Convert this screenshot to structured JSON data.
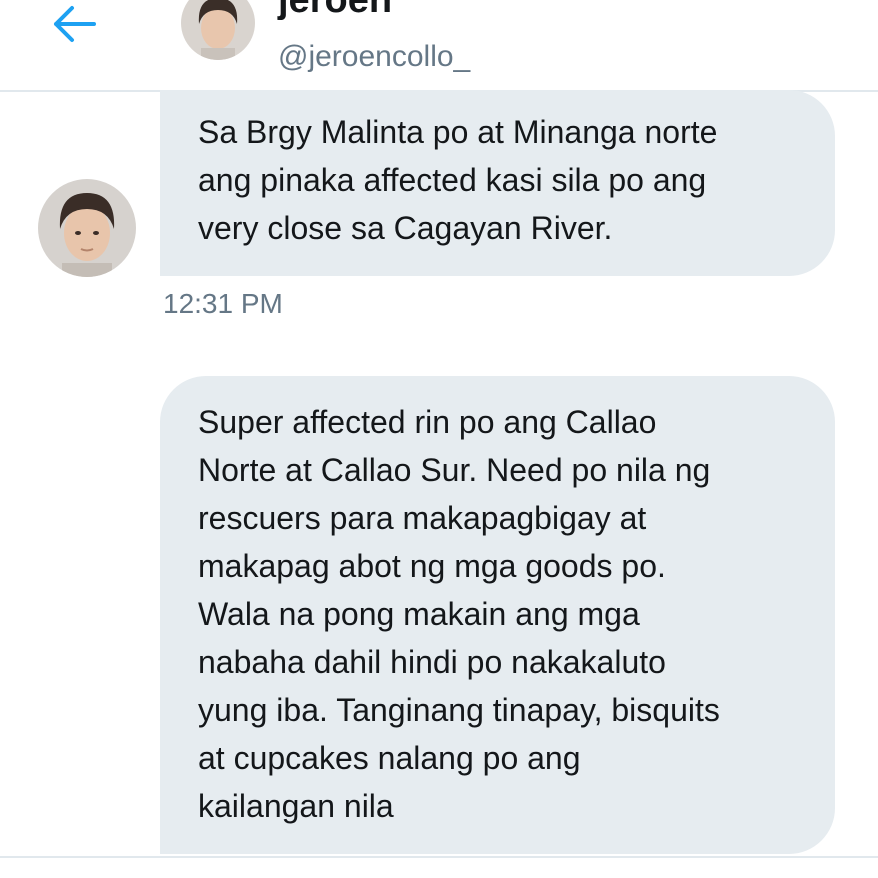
{
  "header": {
    "back_icon": "arrow-left-icon",
    "name": "jeroen",
    "handle": "@jeroencollo_",
    "accent_color": "#1da1f2"
  },
  "messages": [
    {
      "text": "Sa Brgy Malinta po at Minanga norte\nang pinaka affected kasi sila po ang\nvery close sa Cagayan River.",
      "timestamp": "12:31 PM"
    },
    {
      "text": "Super affected rin po ang Callao\nNorte at Callao Sur. Need po nila ng\nrescuers para makapagbigay at\nmakapag abot ng mga goods po.\nWala na pong makain ang mga\nnabaha dahil hindi po nakakaluto\nyung iba. Tanginang tinapay, bisquits\nat cupcakes nalang po ang\nkailangan nila"
    }
  ],
  "colors": {
    "bubble_bg": "#e6ecf0",
    "text": "#14171a",
    "secondary_text": "#657786",
    "divider": "#e1e8ed"
  }
}
